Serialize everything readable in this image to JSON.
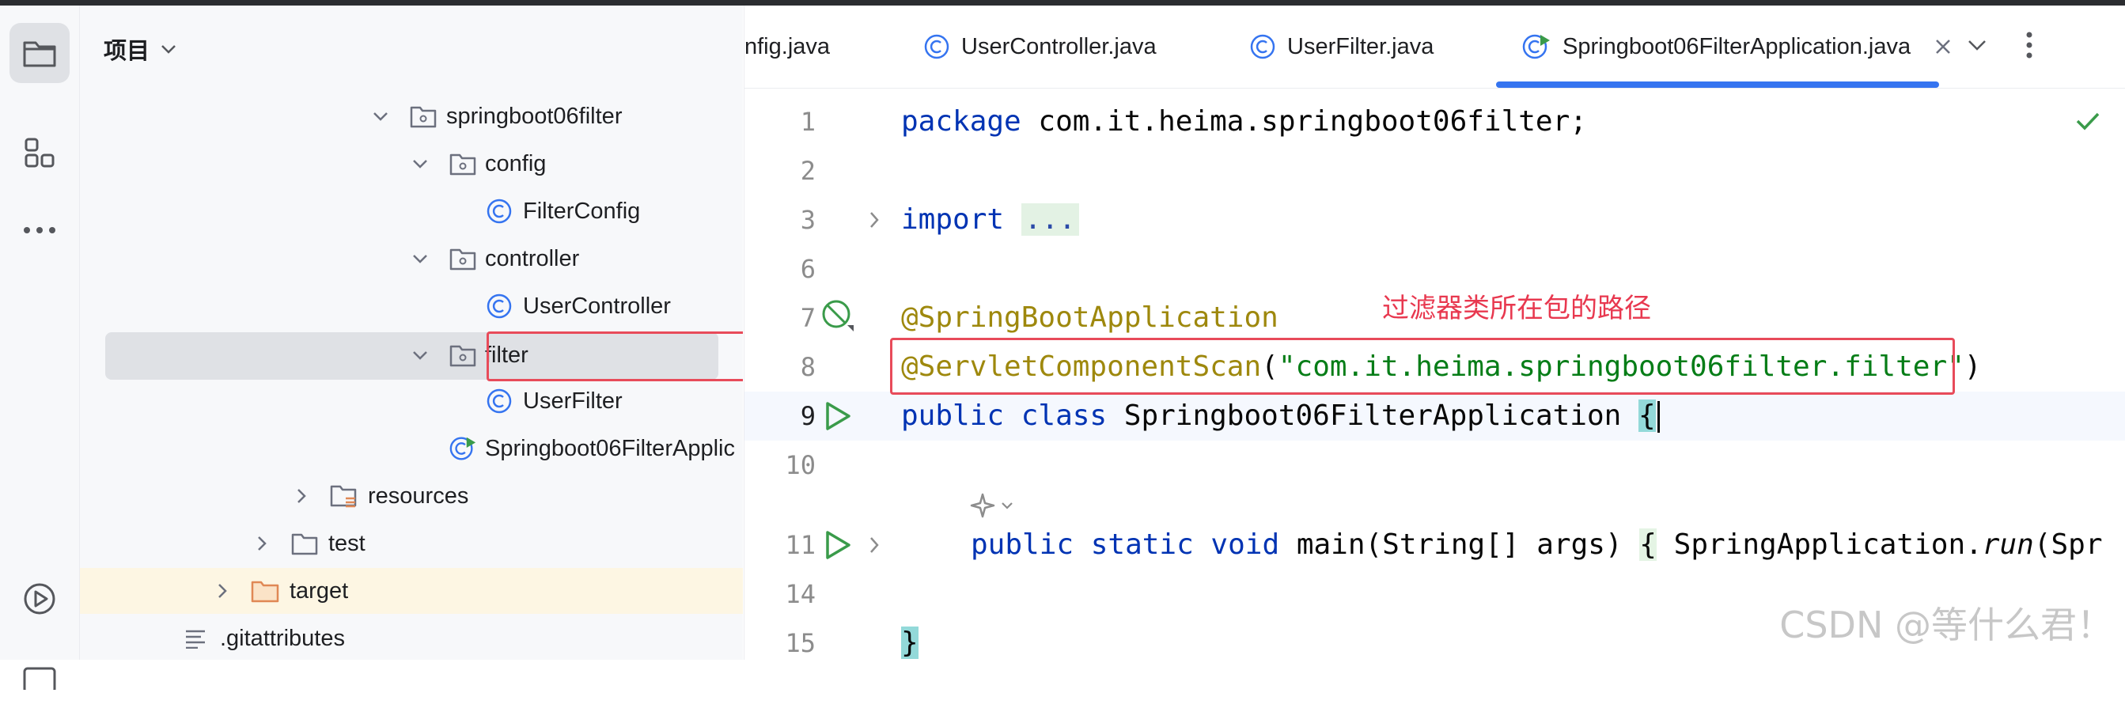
{
  "project_panel": {
    "title": "项目",
    "tree": [
      {
        "label": "springboot06filter",
        "kind": "package"
      },
      {
        "label": "config",
        "kind": "package"
      },
      {
        "label": "FilterConfig",
        "kind": "class"
      },
      {
        "label": "controller",
        "kind": "package"
      },
      {
        "label": "UserController",
        "kind": "class"
      },
      {
        "label": "filter",
        "kind": "package",
        "selected": true,
        "highlighted": true
      },
      {
        "label": "UserFilter",
        "kind": "class"
      },
      {
        "label": "Springboot06FilterApplic",
        "kind": "spring-app-class"
      },
      {
        "label": "resources",
        "kind": "resources-folder"
      },
      {
        "label": "test",
        "kind": "folder"
      },
      {
        "label": "target",
        "kind": "excluded-folder"
      },
      {
        "label": ".gitattributes",
        "kind": "file"
      }
    ]
  },
  "editor": {
    "tabs": [
      {
        "label": "nfig.java",
        "active": false
      },
      {
        "label": "UserController.java",
        "active": false
      },
      {
        "label": "UserFilter.java",
        "active": false
      },
      {
        "label": "Springboot06FilterApplication.java",
        "active": true
      }
    ],
    "line_numbers": [
      "1",
      "2",
      "3",
      "6",
      "7",
      "8",
      "9",
      "10",
      "11",
      "14",
      "15"
    ],
    "code": {
      "l1_kw": "package",
      "l1_rest": " com.it.heima.springboot06filter;",
      "l3_kw": "import",
      "l3_fold": "...",
      "l7_ann": "@SpringBootApplication",
      "l8_ann": "@ServletComponentScan",
      "l8_open": "(",
      "l8_str": "\"com.it.heima.springboot06filter.filter\"",
      "l8_close": ")",
      "l9_kw": "public class",
      "l9_name": " Springboot06FilterApplication ",
      "l9_brace": "{",
      "l11_kw": "public static void",
      "l11_a": " main(String[] args) ",
      "l11_brace": "{",
      "l11_b": " SpringApplication.",
      "l11_run": "run",
      "l11_c": "(Spr",
      "l15_brace": "}"
    },
    "annotation_note": "过滤器类所在包的路径",
    "watermark": "CSDN @等什么君！"
  },
  "colors": {
    "keyword": "#0033b3",
    "annotation": "#9e880d",
    "string": "#067d17",
    "highlight_box": "#e84b5a",
    "tab_underline": "#3574f0",
    "run_icon": "#3a9b4a"
  }
}
